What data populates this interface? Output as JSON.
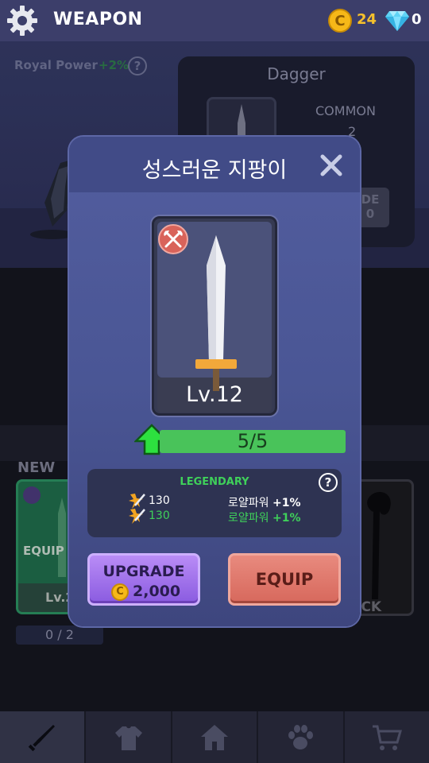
{
  "header": {
    "title": "WEAPON",
    "coins": "24",
    "gems": "0"
  },
  "background": {
    "royal_power_label": "Royal Power",
    "royal_power_bonus": "+2%",
    "help_glyph": "?",
    "item_name": "Dagger",
    "item_rarity": "COMMON",
    "item_attack": "2",
    "upgrade_btn_partial": "DE\n0",
    "new_label": "NEW",
    "left_card_equip": "EQUIP",
    "left_card_level": "Lv.2",
    "left_card_count": "0 / 2",
    "right_card_state": "OCK"
  },
  "modal": {
    "title": "성스러운 지팡이",
    "level": "Lv.12",
    "progress_text": "5/5",
    "progress_fraction": 1.0,
    "rarity": "LEGENDARY",
    "help_glyph": "?",
    "stats": [
      {
        "value": "130",
        "name": "로얄파워",
        "bonus": "+1%"
      },
      {
        "value": "130",
        "name": "로얄파워",
        "bonus": "+1%"
      }
    ],
    "upgrade_label": "UPGRADE",
    "upgrade_coin_glyph": "C",
    "upgrade_cost": "2,000",
    "equip_label": "EQUIP"
  },
  "nav": {
    "items": [
      "sword-icon",
      "shirt-icon",
      "home-icon",
      "paw-icon",
      "cart-icon"
    ],
    "active": "sword-icon"
  },
  "colors": {
    "topbar": "#3c3e6a",
    "modal": "#4a5695",
    "legendary_green": "#3fd05a",
    "upgrade_purple": "#a573ee",
    "equip_red": "#df776b",
    "coin_gold": "#f6b818"
  }
}
